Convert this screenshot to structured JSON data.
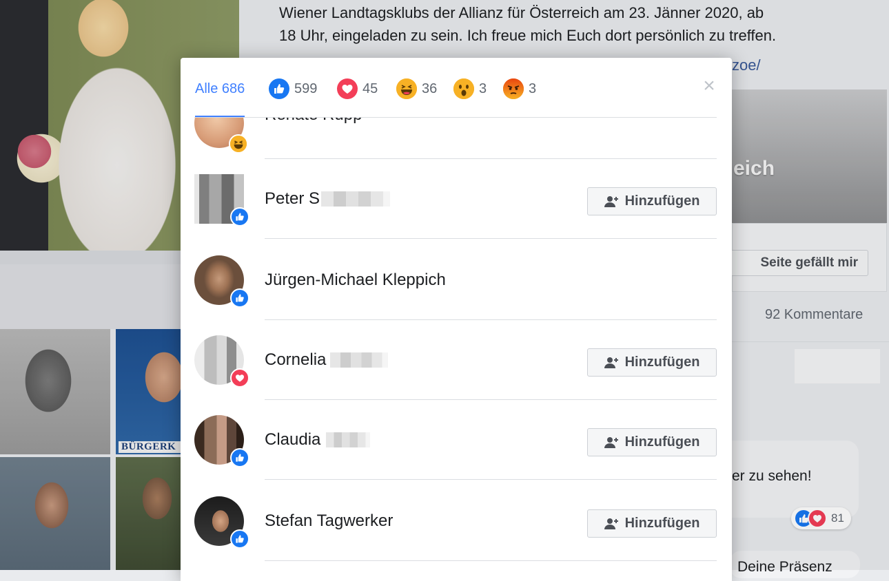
{
  "background": {
    "post_text_line1": "Wiener Landtagsklubs der Allianz für Österreich am 23. Jänner 2020, ab",
    "post_text_line2": "18 Uhr, eingeladen zu sein. Ich freue mich Euch dort persönlich zu treffen.",
    "post_link": "zoe/",
    "preview_text": "eich",
    "like_page_button": "Seite gefällt mir",
    "comments_count": "92 Kommentare",
    "thumb_label": "BÜRGERK",
    "comment_text": "er zu sehen!",
    "comment_reaction_count": "81",
    "comment_text2": "Deine Präsenz"
  },
  "modal": {
    "tabs": [
      {
        "label": "Alle 686",
        "icon": "all",
        "active": true
      },
      {
        "label": "599",
        "icon": "like-icon",
        "color": "#1877f2"
      },
      {
        "label": "45",
        "icon": "love-icon",
        "color": "#f33e58"
      },
      {
        "label": "36",
        "icon": "haha-icon",
        "color": "#f7b125"
      },
      {
        "label": "3",
        "icon": "wow-icon",
        "color": "#f7b125"
      },
      {
        "label": "3",
        "icon": "angry-icon",
        "color": "#e9710f"
      }
    ],
    "close_icon": "close-icon",
    "rows": [
      {
        "name": "Renate Rupp",
        "reaction": "haha",
        "show_add": false,
        "blurred": false
      },
      {
        "name": "Peter S",
        "reaction": "like",
        "show_add": true,
        "blurred": true
      },
      {
        "name": "Jürgen-Michael Kleppich",
        "reaction": "like",
        "show_add": false,
        "blurred": false
      },
      {
        "name": "Cornelia",
        "reaction": "love",
        "show_add": true,
        "blurred": true
      },
      {
        "name": "Claudia",
        "reaction": "like",
        "show_add": true,
        "blurred": true
      },
      {
        "name": "Stefan Tagwerker",
        "reaction": "like",
        "show_add": true,
        "blurred": false
      }
    ],
    "add_button_label": "Hinzufügen"
  },
  "colors": {
    "accent": "#4080ff",
    "like": "#1877f2",
    "love": "#f33e58",
    "haha": "#f7b125",
    "angry": "#e9710f"
  }
}
